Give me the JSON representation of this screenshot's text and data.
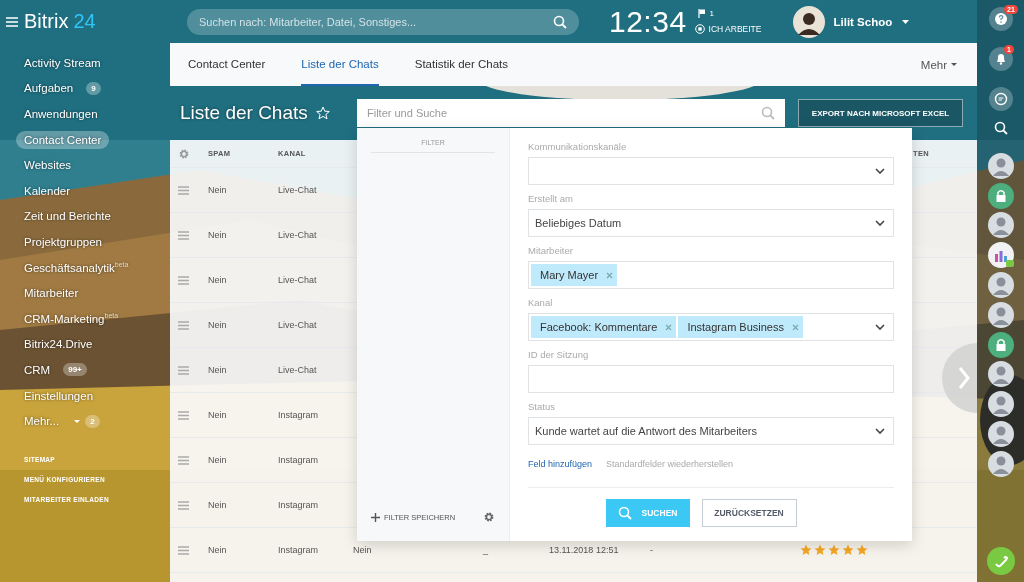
{
  "topbar": {
    "logo": {
      "name": "Bitrix",
      "number": "24"
    },
    "search": {
      "placeholder": "Suchen nach: Mitarbeiter, Datei, Sonstiges..."
    },
    "clock": "12:34",
    "flag_count": "1",
    "work_status": "ICH ARBEITE",
    "user": {
      "name": "Lilit Schoo"
    }
  },
  "sidebar": {
    "items": [
      {
        "label": "Activity Stream",
        "selected": false
      },
      {
        "label": "Aufgaben",
        "badge": "9",
        "selected": false
      },
      {
        "label": "Anwendungen",
        "selected": false
      },
      {
        "label": "Contact Center",
        "selected": true
      },
      {
        "label": "Websites",
        "selected": false
      },
      {
        "label": "Kalender",
        "selected": false
      },
      {
        "label": "Zeit und Berichte",
        "selected": false
      },
      {
        "label": "Projektgruppen",
        "selected": false
      },
      {
        "label": "Geschäftsanalytik$^{beta}$",
        "selected": false
      },
      {
        "label": "Mitarbeiter",
        "selected": false
      },
      {
        "label": "CRM-Marketing$^{beta}$",
        "selected": false
      },
      {
        "label": "Bitrix24.Drive",
        "selected": false
      },
      {
        "label": "CRM",
        "badge": "99+",
        "selected": false
      },
      {
        "label": "Einstellungen",
        "selected": false
      },
      {
        "label": "Mehr...",
        "badge": "2",
        "dropdown": true,
        "selected": false
      }
    ],
    "links": [
      "SITEMAP",
      "MENÜ KONFIGURIEREN",
      "MITARBEITER EINLADEN"
    ]
  },
  "tabs": [
    {
      "label": "Contact Center",
      "selected": false
    },
    {
      "label": "Liste der Chats",
      "selected": true
    },
    {
      "label": "Statistik der Chats",
      "selected": false
    }
  ],
  "tabs_more": "Mehr",
  "page": {
    "title": "Liste der Chats",
    "favorite": false
  },
  "filter_search": {
    "placeholder": "Filter und Suche"
  },
  "export_button": "EXPORT NACH MICROSOFT EXCEL",
  "table": {
    "columns": [
      "SPAM",
      "KANAL"
    ],
    "column_8": "TEN",
    "rows": [
      {
        "spam": "Nein",
        "kanal": "Live-Chat"
      },
      {
        "spam": "Nein",
        "kanal": "Live-Chat"
      },
      {
        "spam": "Nein",
        "kanal": "Live-Chat"
      },
      {
        "spam": "Nein",
        "kanal": "Live-Chat"
      },
      {
        "spam": "Nein",
        "kanal": "Live-Chat"
      },
      {
        "spam": "Nein",
        "kanal": "Instagram"
      },
      {
        "spam": "Nein",
        "kanal": "Instagram"
      },
      {
        "spam": "Nein",
        "kanal": "Instagram"
      },
      {
        "spam": "Nein",
        "kanal": "Instagram",
        "column_3": "Nein",
        "column_4": "_",
        "column_5": "13.11.2018 12:51",
        "column_6": "-",
        "stars": 5
      }
    ]
  },
  "filter_popup": {
    "title": "FILTER",
    "save_label": "FILTER SPEICHERN",
    "fields": [
      {
        "label": "Kommunikationskanäle",
        "kind": "select"
      },
      {
        "label": "Erstellt am",
        "kind": "select",
        "value": "Beliebiges Datum"
      },
      {
        "label": "Mitarbeiter",
        "kind": "tags",
        "tags": [
          "Mary Mayer"
        ],
        "dropdown": false
      },
      {
        "label": "Kanal",
        "kind": "tags",
        "tags": [
          "Facebook: Kommentare",
          "Instagram Business"
        ],
        "dropdown": true
      },
      {
        "label": "ID der Sitzung",
        "kind": "input"
      },
      {
        "label": "Status",
        "kind": "select",
        "value": "Kunde wartet auf die Antwort des Mitarbeiters"
      }
    ],
    "links": [
      {
        "label": "Feld hinzufügen",
        "kind": "primary"
      },
      {
        "label": "Standardfelder wiederherstellen",
        "kind": "secondary"
      }
    ],
    "buttons": [
      {
        "label": "SUCHEN",
        "kind": "primary"
      },
      {
        "label": "ZURÜCKSETZEN",
        "kind": "secondary"
      }
    ]
  },
  "right_rail": {
    "help_badge": "21",
    "notification_badge": "1",
    "contacts": [
      {
        "kind": "avatar",
        "online": false
      },
      {
        "kind": "locked",
        "online": false
      },
      {
        "kind": "avatar",
        "online": false
      },
      {
        "kind": "chart",
        "online": true
      },
      {
        "kind": "avatar",
        "online": false
      },
      {
        "kind": "avatar",
        "online": false
      },
      {
        "kind": "locked",
        "online": false
      },
      {
        "kind": "avatar",
        "online": false
      },
      {
        "kind": "avatar",
        "online": false
      },
      {
        "kind": "avatar",
        "online": false
      },
      {
        "kind": "avatar",
        "online": false
      }
    ]
  }
}
